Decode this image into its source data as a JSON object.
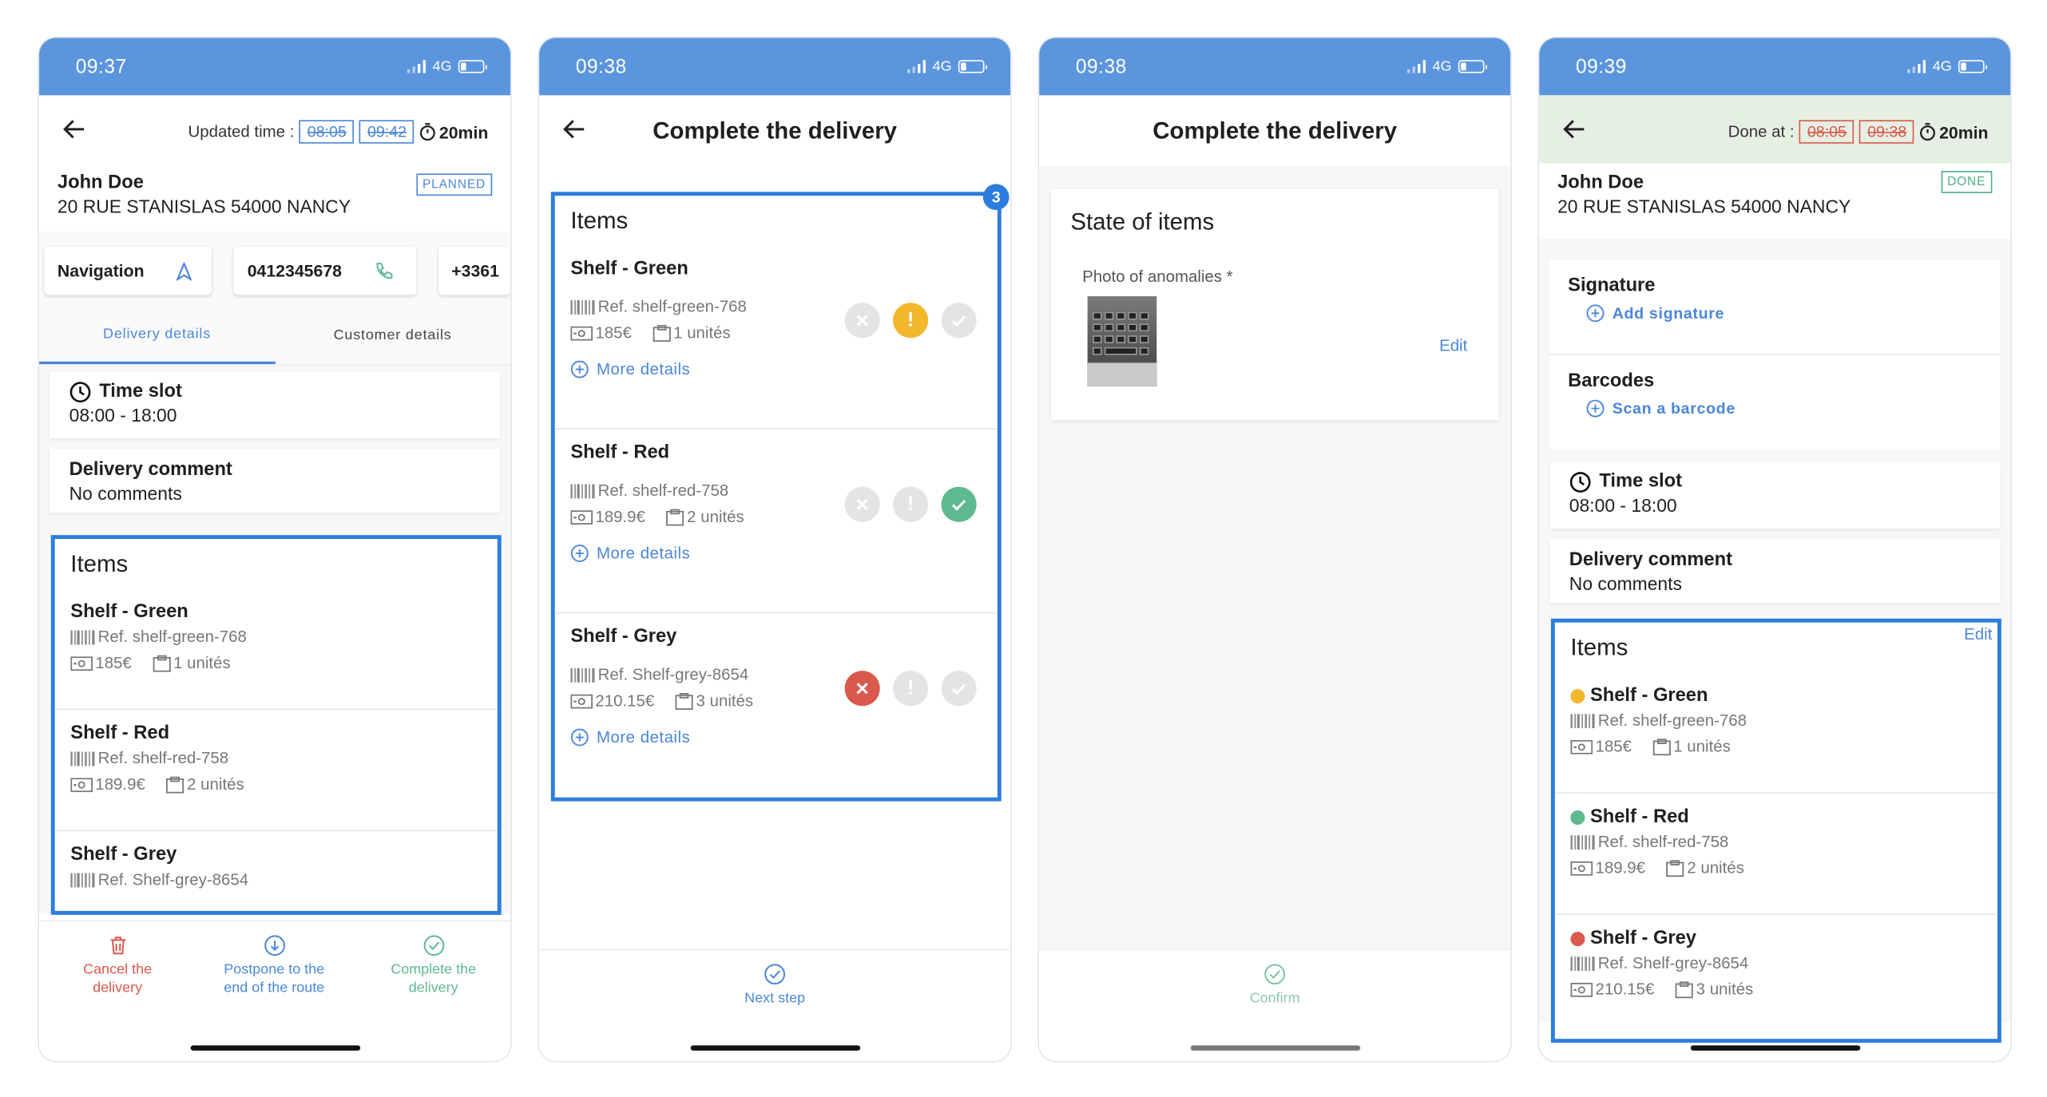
{
  "status_bars": [
    {
      "time": "09:37",
      "network": "4G"
    },
    {
      "time": "09:38",
      "network": "4G"
    },
    {
      "time": "09:38",
      "network": "4G"
    },
    {
      "time": "09:39",
      "network": "4G"
    }
  ],
  "screen1": {
    "updated_label": "Updated time :",
    "old_time": "08:05",
    "new_time": "09:42",
    "duration": "20min",
    "customer_name": "John Doe",
    "address": "20 RUE STANISLAS 54000 NANCY",
    "status_badge": "PLANNED",
    "pills": {
      "navigation": "Navigation",
      "phone": "0412345678",
      "phone2": "+3361"
    },
    "tabs": [
      "Delivery details",
      "Customer details"
    ],
    "time_slot_title": "Time slot",
    "time_slot_value": "08:00 - 18:00",
    "comment_title": "Delivery comment",
    "comment_value": "No comments",
    "items_title": "Items",
    "items": [
      {
        "name": "Shelf - Green",
        "ref": "Ref. shelf-green-768",
        "price": "185€",
        "qty": "1 unités"
      },
      {
        "name": "Shelf - Red",
        "ref": "Ref. shelf-red-758",
        "price": "189.9€",
        "qty": "2 unités"
      },
      {
        "name": "Shelf - Grey",
        "ref": "Ref. Shelf-grey-8654"
      }
    ],
    "actions": {
      "cancel": [
        "Cancel the",
        "delivery"
      ],
      "postpone": [
        "Postpone to the",
        "end of the route"
      ],
      "complete": [
        "Complete the",
        "delivery"
      ]
    }
  },
  "screen2": {
    "title": "Complete the delivery",
    "items_title": "Items",
    "counter": "3",
    "more_details": "More details",
    "items": [
      {
        "name": "Shelf - Green",
        "ref": "Ref. shelf-green-768",
        "price": "185€",
        "qty": "1 unités",
        "state": "anomaly"
      },
      {
        "name": "Shelf - Red",
        "ref": "Ref. shelf-red-758",
        "price": "189.9€",
        "qty": "2 unités",
        "state": "ok"
      },
      {
        "name": "Shelf - Grey",
        "ref": "Ref. Shelf-grey-8654",
        "price": "210.15€",
        "qty": "3 unités",
        "state": "refused"
      }
    ],
    "next_step": "Next step"
  },
  "screen3": {
    "title": "Complete the delivery",
    "state_title": "State of items",
    "photo_label": "Photo of anomalies *",
    "edit": "Edit",
    "confirm": "Confirm"
  },
  "screen4": {
    "done_label": "Done at :",
    "old_time": "08:05",
    "new_time": "09:38",
    "duration": "20min",
    "customer_name": "John Doe",
    "address": "20 RUE STANISLAS 54000 NANCY",
    "status_badge": "DONE",
    "signature_title": "Signature",
    "add_signature": "Add signature",
    "barcodes_title": "Barcodes",
    "scan_barcode": "Scan a barcode",
    "time_slot_title": "Time slot",
    "time_slot_value": "08:00 - 18:00",
    "comment_title": "Delivery comment",
    "comment_value": "No comments",
    "items_title": "Items",
    "edit": "Edit",
    "items": [
      {
        "name": "Shelf - Green",
        "ref": "Ref. shelf-green-768",
        "price": "185€",
        "qty": "1 unités",
        "state_color": "#f3b72c"
      },
      {
        "name": "Shelf - Red",
        "ref": "Ref. shelf-red-758",
        "price": "189.9€",
        "qty": "2 unités",
        "state_color": "#5fb98f"
      },
      {
        "name": "Shelf - Grey",
        "ref": "Ref. Shelf-grey-8654",
        "price": "210.15€",
        "qty": "3 unités",
        "state_color": "#d9594c"
      }
    ]
  },
  "colors": {
    "header_blue": "#5b95de",
    "header_done": "#e6efe3",
    "accent": "#2c7ddf",
    "cancel": "#d9594c",
    "complete": "#5fb98f"
  }
}
